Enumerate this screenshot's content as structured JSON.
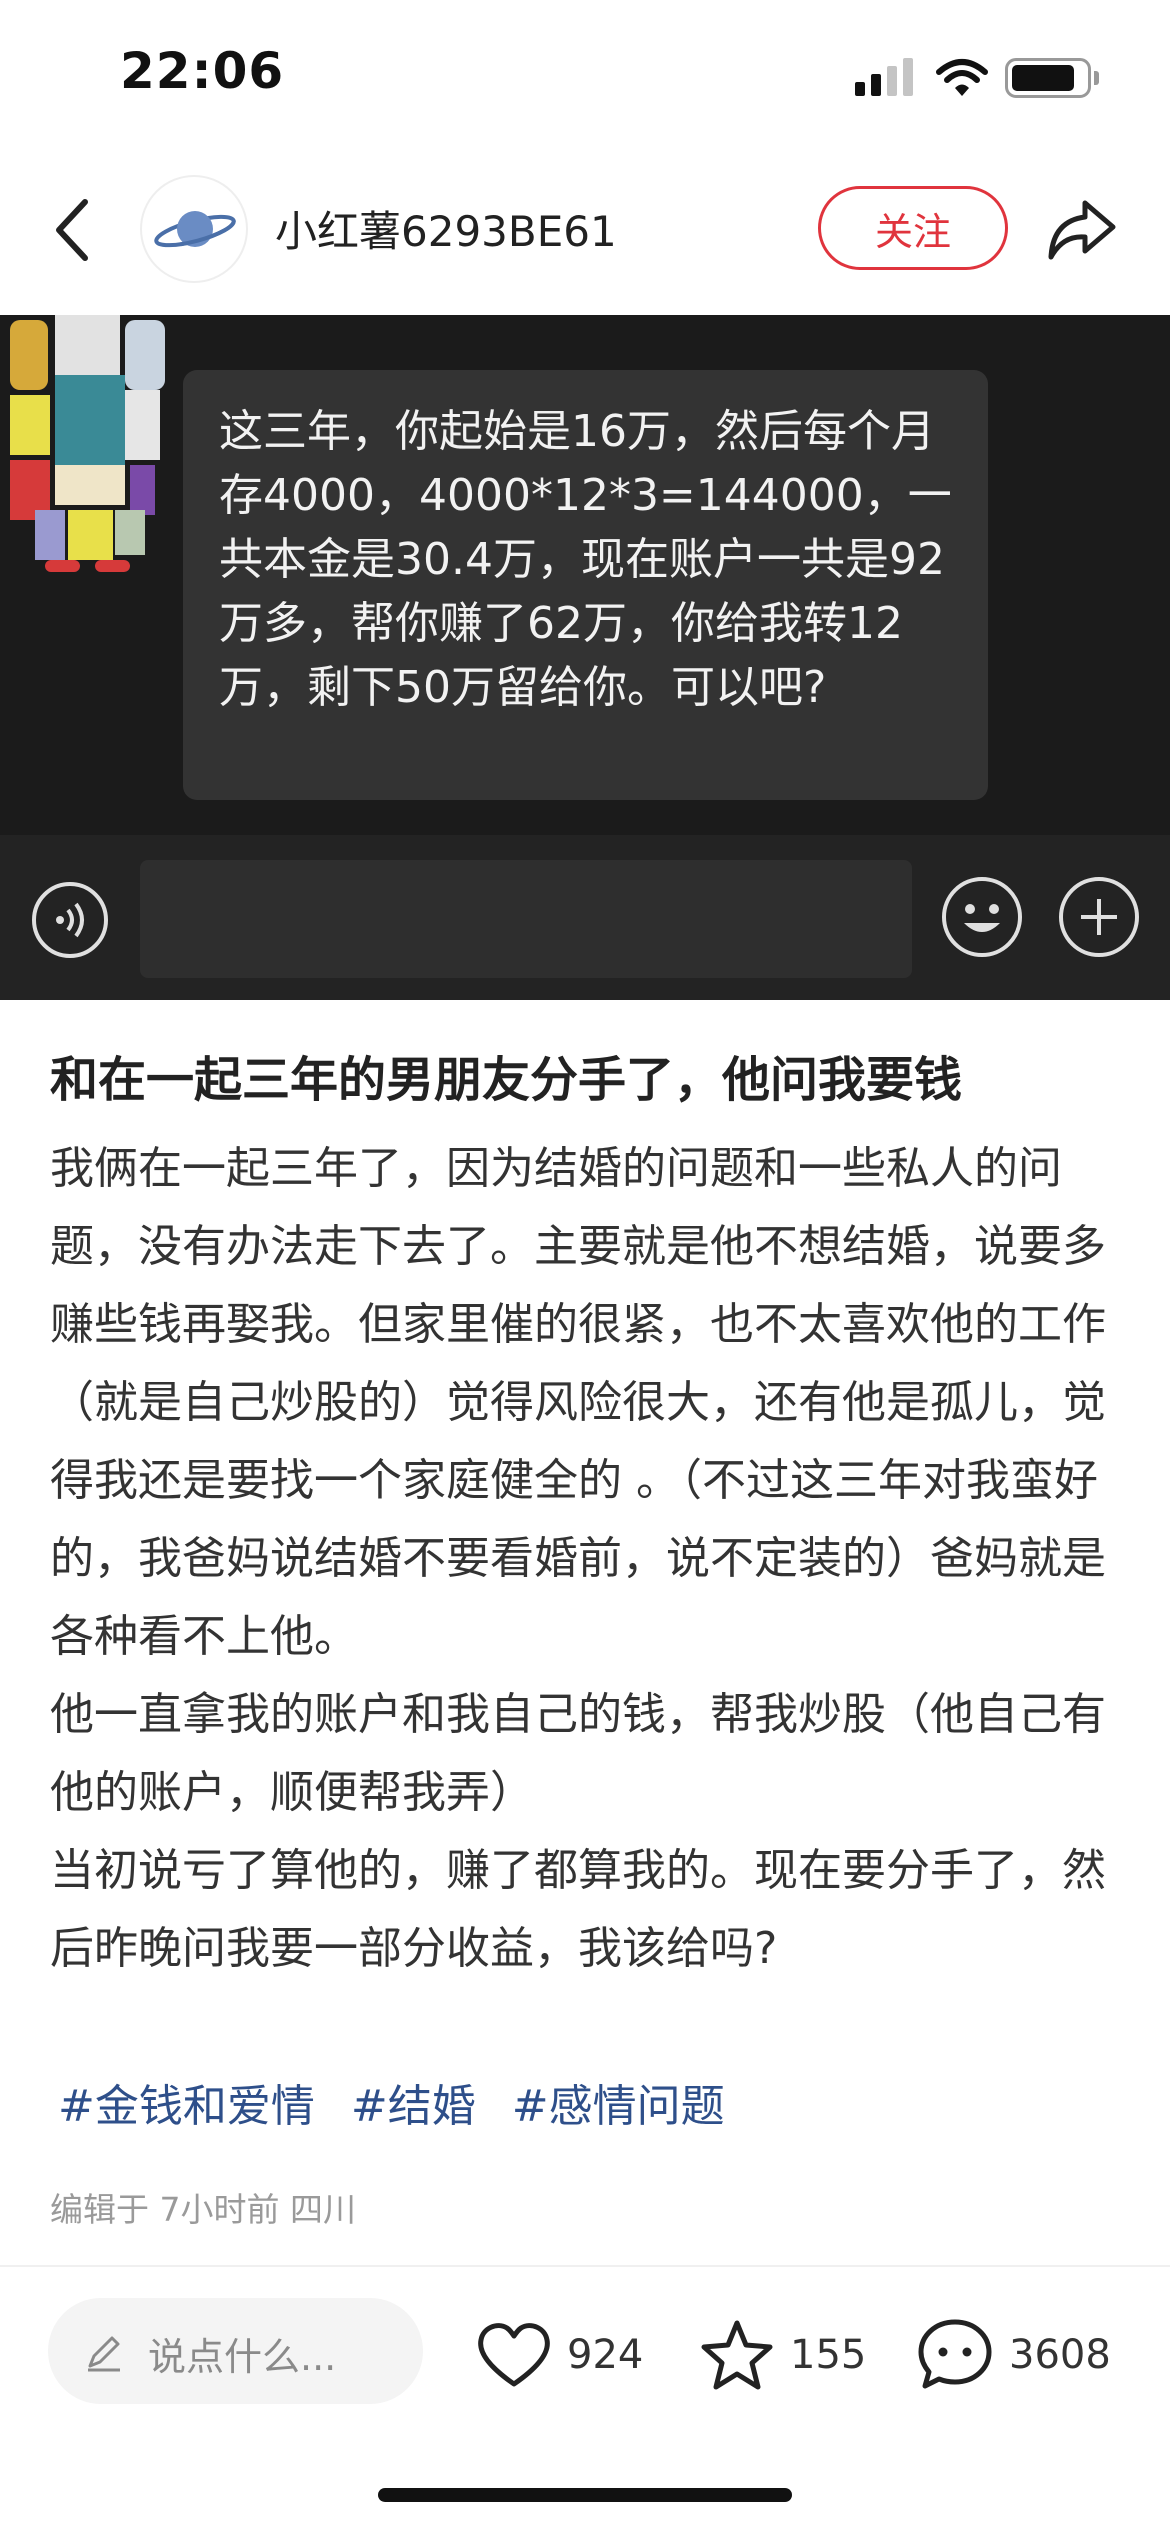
{
  "status_bar": {
    "time": "22:06"
  },
  "nav": {
    "username": "小红薯6293BE61",
    "follow_label": "关注"
  },
  "chat_image": {
    "message": "这三年，你起始是16万，然后每个月存4000，4000*12*3=144000，一共本金是30.4万，现在账户一共是92万多，帮你赚了62万，你给我转12万，剩下50万留给你。可以吧?"
  },
  "post": {
    "title": "和在一起三年的男朋友分手了，他问我要钱",
    "body": "我俩在一起三年了，因为结婚的问题和一些私人的问题，没有办法走下去了。主要就是他不想结婚，说要多赚些钱再娶我。但家里催的很紧，也不太喜欢他的工作（就是自己炒股的）觉得风险很大，还有他是孤儿，觉得我还是要找一个家庭健全的 。（不过这三年对我蛮好的，我爸妈说结婚不要看婚前，说不定装的）爸妈就是各种看不上他。\n他一直拿我的账户和我自己的钱，帮我炒股（他自己有他的账户，顺便帮我弄）\n当初说亏了算他的，赚了都算我的。现在要分手了，然后昨晚问我要一部分收益，我该给吗?",
    "tags": [
      "#金钱和爱情",
      "#结婚",
      "#感情问题"
    ],
    "meta": "编辑于 7小时前 四川"
  },
  "bottom_bar": {
    "comment_placeholder": "说点什么...",
    "likes": "924",
    "collects": "155",
    "comments": "3608"
  },
  "colors": {
    "accent_red": "#e0343d",
    "tag_blue": "#2e4f8a",
    "hero_bg": "#1b1b1b",
    "bubble_bg": "#333333"
  },
  "icons": [
    "back-icon",
    "share-icon",
    "voice-icon",
    "emoji-icon",
    "plus-icon",
    "pencil-icon",
    "heart-icon",
    "star-icon",
    "comment-icon"
  ]
}
